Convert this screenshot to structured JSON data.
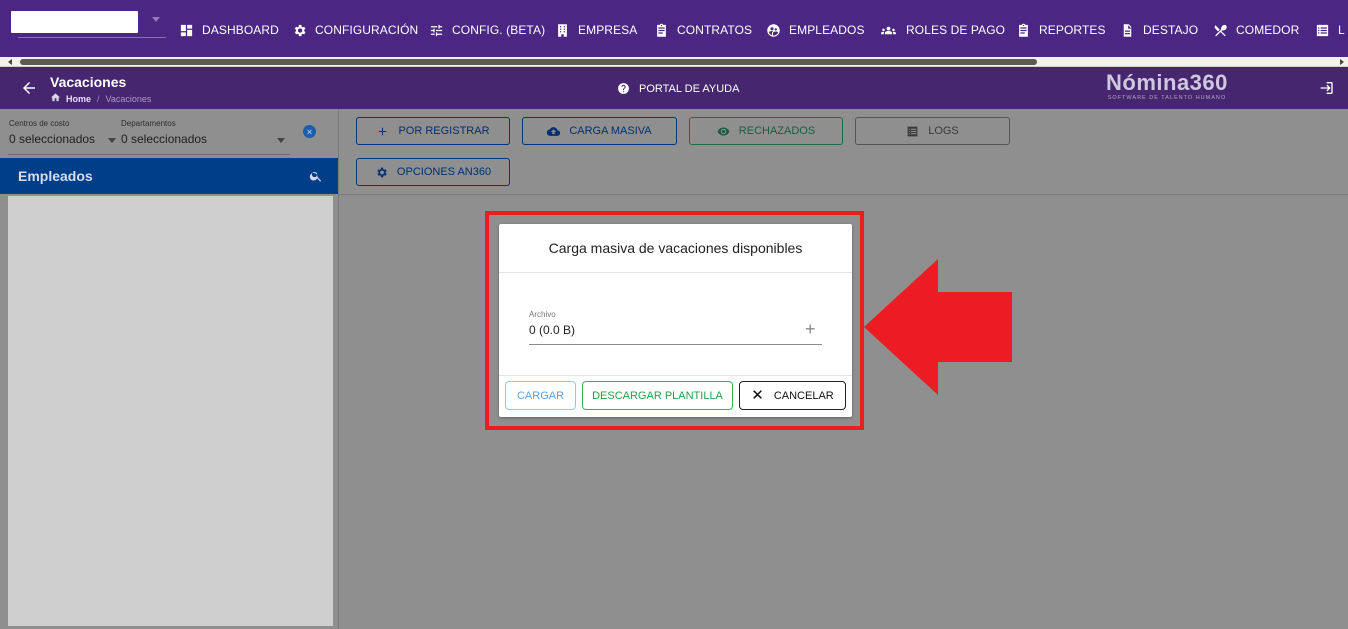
{
  "nav": {
    "items": [
      {
        "label": "DASHBOARD",
        "icon": "dashboard-icon"
      },
      {
        "label": "CONFIGURACIÓN",
        "icon": "gear-icon"
      },
      {
        "label": "CONFIG. (BETA)",
        "icon": "sliders-icon"
      },
      {
        "label": "EMPRESA",
        "icon": "building-icon"
      },
      {
        "label": "CONTRATOS",
        "icon": "clipboard-icon"
      },
      {
        "label": "EMPLEADOS",
        "icon": "employees-icon"
      },
      {
        "label": "ROLES DE PAGO",
        "icon": "group-icon"
      },
      {
        "label": "REPORTES",
        "icon": "report-icon"
      },
      {
        "label": "DESTAJO",
        "icon": "document-icon"
      },
      {
        "label": "COMEDOR",
        "icon": "utensils-icon"
      },
      {
        "label": "L",
        "icon": "list-icon"
      }
    ]
  },
  "header": {
    "title": "Vacaciones",
    "breadcrumb_home": "Home",
    "breadcrumb_sep": "/",
    "breadcrumb_current": "Vacaciones",
    "help_label": "PORTAL DE AYUDA",
    "logo_name": "Nómina360",
    "logo_tagline": "SOFTWARE DE TALENTO HUMANO"
  },
  "filters": {
    "cost_centers_label": "Centros de costo",
    "cost_centers_value": "0 seleccionados",
    "departments_label": "Departamentos",
    "departments_value": "0 seleccionados",
    "clear_symbol": "×"
  },
  "employees": {
    "title": "Empleados"
  },
  "toolbar": {
    "por_registrar": "POR REGISTRAR",
    "carga_masiva": "CARGA MASIVA",
    "rechazados": "RECHAZADOS",
    "logs": "LOGS",
    "opciones": "OPCIONES AN360"
  },
  "dialog": {
    "title": "Carga masiva de vacaciones disponibles",
    "file_label": "Archivo",
    "file_value": "0 (0.0 B)",
    "file_add": "+",
    "cargar": "CARGAR",
    "descargar": "DESCARGAR PLANTILLA",
    "cancelar_icon": "✕",
    "cancelar": "CANCELAR"
  },
  "colors": {
    "nav_bg": "#4b2683",
    "header_bg": "#46276f",
    "employees_bar": "#003e8a",
    "highlight": "#ed1c24"
  }
}
